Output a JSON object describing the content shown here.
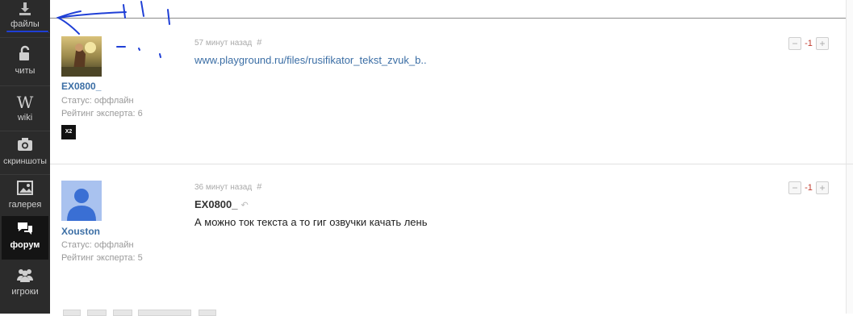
{
  "sidebar": {
    "items": [
      {
        "label": "файлы",
        "icon": "download-icon"
      },
      {
        "label": "читы",
        "icon": "unlock-icon"
      },
      {
        "label": "wiki",
        "icon": "wikipedia-icon"
      },
      {
        "label": "скриншоты",
        "icon": "camera-icon"
      },
      {
        "label": "галерея",
        "icon": "image-icon"
      },
      {
        "label": "форум",
        "icon": "forum-chat-icon"
      },
      {
        "label": "игроки",
        "icon": "users-icon"
      }
    ],
    "active": "форум"
  },
  "posts": [
    {
      "author": "EX0800_",
      "status": "Статус: оффлайн",
      "rating": "Рейтинг эксперта: 6",
      "badge": "X2",
      "time": "57 минут назад",
      "hash": "#",
      "link": "www.playground.ru/files/rusifikator_tekst_zvuk_b..",
      "vote_minus": "−",
      "vote_score": "1",
      "vote_plus": "+"
    },
    {
      "author": "Xouston",
      "status": "Статус: оффлайн",
      "rating": "Рейтинг эксперта: 5",
      "time": "36 минут назад",
      "hash": "#",
      "reply_to": "EX0800_",
      "text": "А можно ток текста а то гиг озвучки качать лень",
      "vote_minus": "−",
      "vote_score": "1",
      "vote_plus": "+"
    }
  ],
  "colors": {
    "sidebar_bg": "#2b2b2b",
    "sidebar_active": "#141414",
    "link": "#3b6ea5",
    "vote_negative": "#c0392b",
    "scribble": "#1f3fd6"
  }
}
